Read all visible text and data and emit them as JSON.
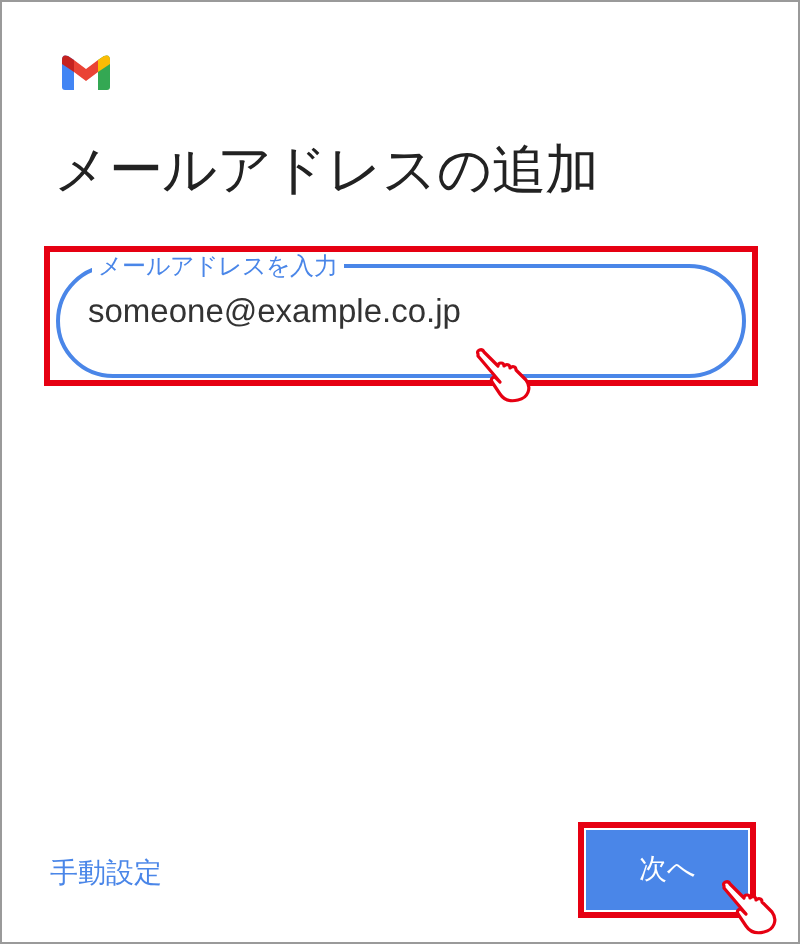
{
  "title": "メールアドレスの追加",
  "email_field": {
    "label": "メールアドレスを入力",
    "value": "someone@example.co.jp"
  },
  "manual_setup_link": "手動設定",
  "next_button": "次へ"
}
